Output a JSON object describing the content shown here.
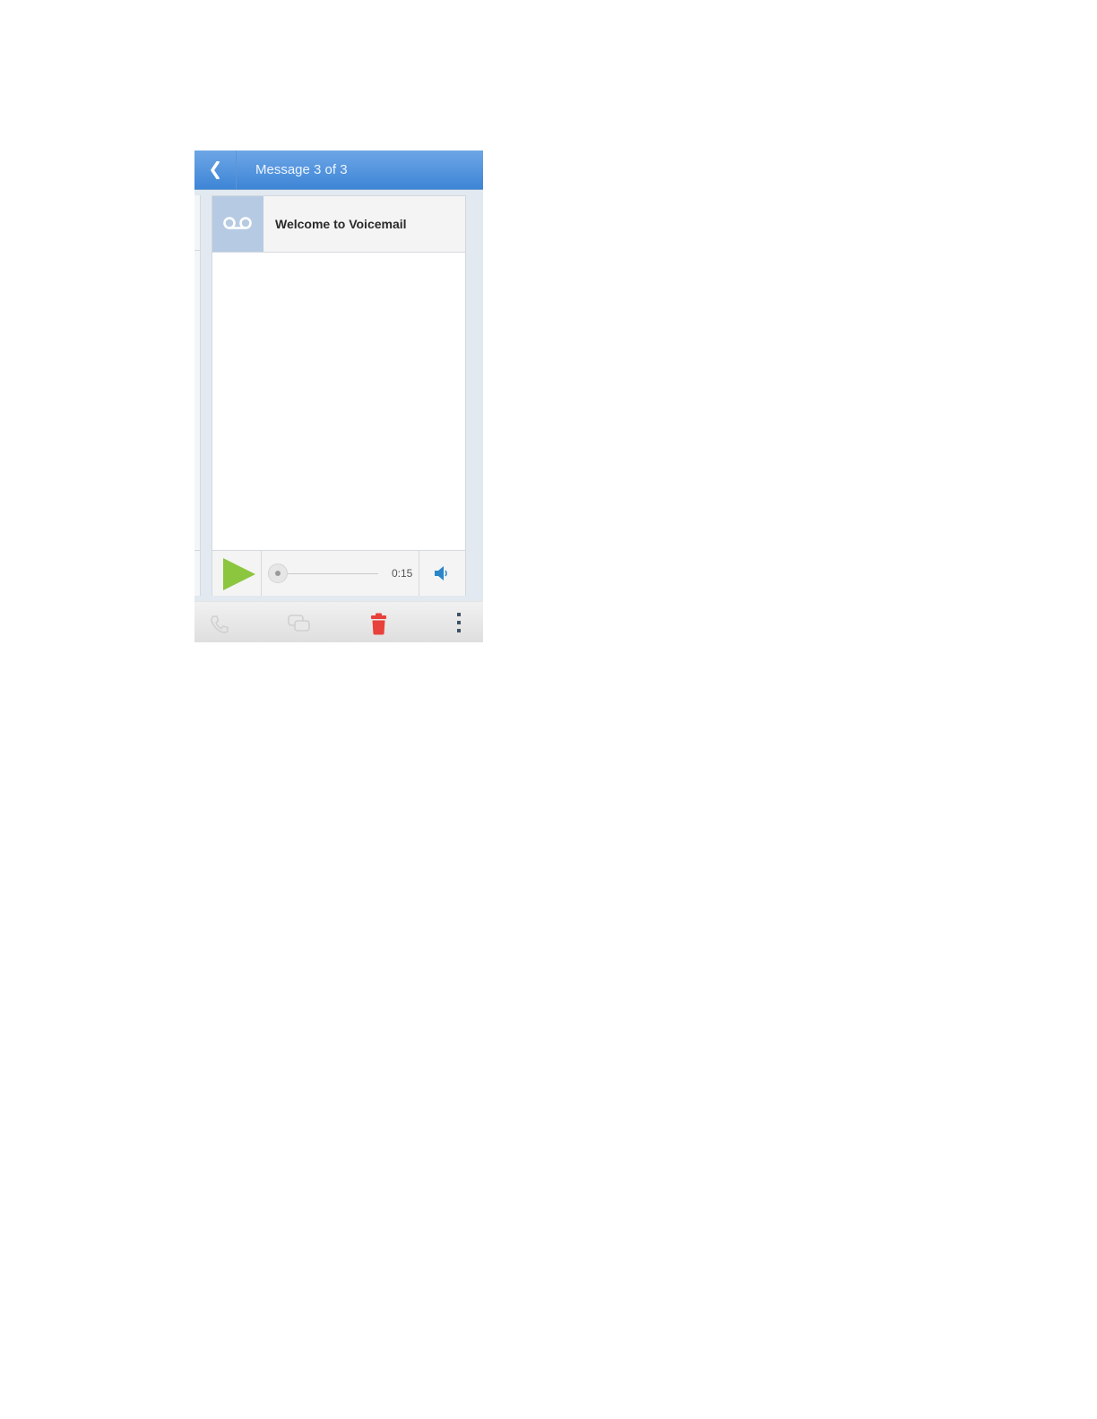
{
  "header": {
    "back_icon": "chevron-left-icon",
    "title": "Message 3 of 3",
    "colors": {
      "bar": "#3d85d6",
      "title_text": "#eef5ff"
    }
  },
  "message": {
    "icon": "voicemail-icon",
    "title": "Welcome to Voicemail"
  },
  "player": {
    "play_icon": "play-icon",
    "play_color": "#8cc63f",
    "progress_fraction": 0,
    "duration": "0:15",
    "speaker_icon": "speaker-icon",
    "speaker_color": "#2a86c8"
  },
  "toolbar": {
    "items": [
      {
        "icon": "phone-icon",
        "enabled": false
      },
      {
        "icon": "message-icon",
        "enabled": false
      },
      {
        "icon": "trash-icon",
        "enabled": true,
        "color": "#e8403a"
      },
      {
        "icon": "overflow-menu-icon",
        "enabled": true
      }
    ]
  }
}
